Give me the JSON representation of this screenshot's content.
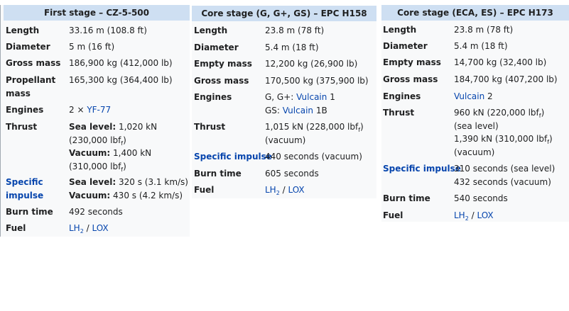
{
  "stage1": {
    "title": "First stage – CZ-5-500",
    "rows": {
      "length": {
        "label": "Length",
        "value": "33.16 m (108.8 ft)"
      },
      "diameter": {
        "label": "Diameter",
        "value": "5 m (16 ft)"
      },
      "gross_mass": {
        "label": "Gross mass",
        "value": "186,900 kg (412,000 lb)"
      },
      "propellant_mass": {
        "label_line1": "Propellant",
        "label_line2": "mass",
        "value": "165,300 kg (364,400 lb)"
      },
      "engines": {
        "label": "Engines",
        "prefix": "2 × ",
        "link": "YF-77"
      },
      "thrust": {
        "label": "Thrust",
        "sl_label": "Sea level:",
        "sl_value": " 1,020 kN",
        "sl_paren_a": "(230,000 lbf",
        "sub_f": "f",
        "close": ")",
        "vac_label": "Vacuum:",
        "vac_value": " 1,400 kN",
        "vac_paren_a": "(310,000 lbf"
      },
      "specific_impulse": {
        "label_line1": "Specific",
        "label_line2": "impulse",
        "sl_label": "Sea level:",
        "sl_value": " 320 s (3.1 km/s)",
        "vac_label": "Vacuum:",
        "vac_value": " 430 s (4.2 km/s)"
      },
      "burn_time": {
        "label": "Burn time",
        "value": "492 seconds"
      },
      "fuel": {
        "label": "Fuel",
        "lh": "LH",
        "sub2": "2",
        "sep": " / ",
        "lox": "LOX"
      }
    }
  },
  "stage2": {
    "title": "Core stage (G, G+, GS) – EPC H158",
    "rows": {
      "length": {
        "label": "Length",
        "value": "23.8 m (78 ft)"
      },
      "diameter": {
        "label": "Diameter",
        "value": "5.4 m (18 ft)"
      },
      "empty_mass": {
        "label": "Empty mass",
        "value": "12,200 kg (26,900 lb)"
      },
      "gross_mass": {
        "label": "Gross mass",
        "value": "170,500 kg (375,900 lb)"
      },
      "engines": {
        "label": "Engines",
        "line1_prefix": "G, G+: ",
        "line1_link": "Vulcain",
        "line1_suffix": " 1",
        "line2_prefix": "GS: ",
        "line2_link": "Vulcain",
        "line2_suffix": " 1B"
      },
      "thrust": {
        "label": "Thrust",
        "line1": "1,015 kN (228,000 lbf",
        "sub_f": "f",
        "close": ")",
        "line2": "(vacuum)"
      },
      "specific_impulse": {
        "label": "Specific impulse",
        "value": "440 seconds (vacuum)"
      },
      "burn_time": {
        "label": "Burn time",
        "value": "605 seconds"
      },
      "fuel": {
        "label": "Fuel",
        "lh": "LH",
        "sub2": "2",
        "sep": " / ",
        "lox": "LOX"
      }
    }
  },
  "stage3": {
    "title": "Core stage (ECA, ES) – EPC H173",
    "rows": {
      "length": {
        "label": "Length",
        "value": "23.8 m (78 ft)"
      },
      "diameter": {
        "label": "Diameter",
        "value": "5.4 m (18 ft)"
      },
      "empty_mass": {
        "label": "Empty mass",
        "value": "14,700 kg (32,400 lb)"
      },
      "gross_mass": {
        "label": "Gross mass",
        "value": "184,700 kg (407,200 lb)"
      },
      "engines": {
        "label": "Engines",
        "link": "Vulcain",
        "suffix": " 2"
      },
      "thrust": {
        "label": "Thrust",
        "line1": "960 kN (220,000 lbf",
        "sub_f": "f",
        "close": ")",
        "line2": "(sea level)",
        "line3": "1,390 kN (310,000 lbf",
        "line4": "(vacuum)"
      },
      "specific_impulse": {
        "label": "Specific impulse",
        "line1": "310 seconds (sea level)",
        "line2": "432 seconds (vacuum)"
      },
      "burn_time": {
        "label": "Burn time",
        "value": "540 seconds"
      },
      "fuel": {
        "label": "Fuel",
        "lh": "LH",
        "sub2": "2",
        "sep": " / ",
        "lox": "LOX"
      }
    }
  },
  "colors": {
    "header_bg": "#cedff2",
    "body_bg": "#f8f9fa",
    "link": "#0645ad",
    "text": "#202122"
  }
}
